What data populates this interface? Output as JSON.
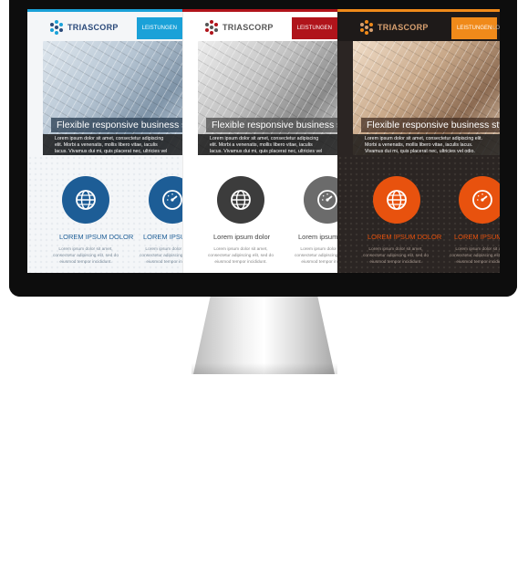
{
  "brand": "TRIASCORP",
  "nav": {
    "leistungen": "LEISTUNGEN",
    "next_partial": "LO"
  },
  "hero": {
    "title": "Flexible responsive business style",
    "text": "Lorem ipsum dolor sit amet, consectetur adipiscing elit. Morbi a venenatis, mollis libero vitae, iaculis lacus. Vivamus dui mi, quis placerat nec, ultricies vel odio."
  },
  "features": {
    "title_upper": "LOREM IPSUM DOLOR",
    "title_upper_partial": "LOREM IPSUM",
    "title_normal": "Lorem ipsum dolor",
    "title_normal_partial": "Lorem ipsum",
    "text": "Lorem ipsum dolor sit amet, consectetur adipiscing elit, sed do eiusmod tempor incididunt."
  },
  "icons": {
    "feature_1": "globe-icon",
    "feature_2": "speedometer-icon",
    "logo": "hexagon-dots-logo",
    "hardware": "apple-logo"
  },
  "colors": {
    "blue_accent": "#1aa1d8",
    "blue_circle": "#1d5d96",
    "gray_accent": "#b0141b",
    "gray_circle": "#3c3c3c",
    "dark_accent": "#f08a1a",
    "dark_circle": "#e8520e"
  }
}
